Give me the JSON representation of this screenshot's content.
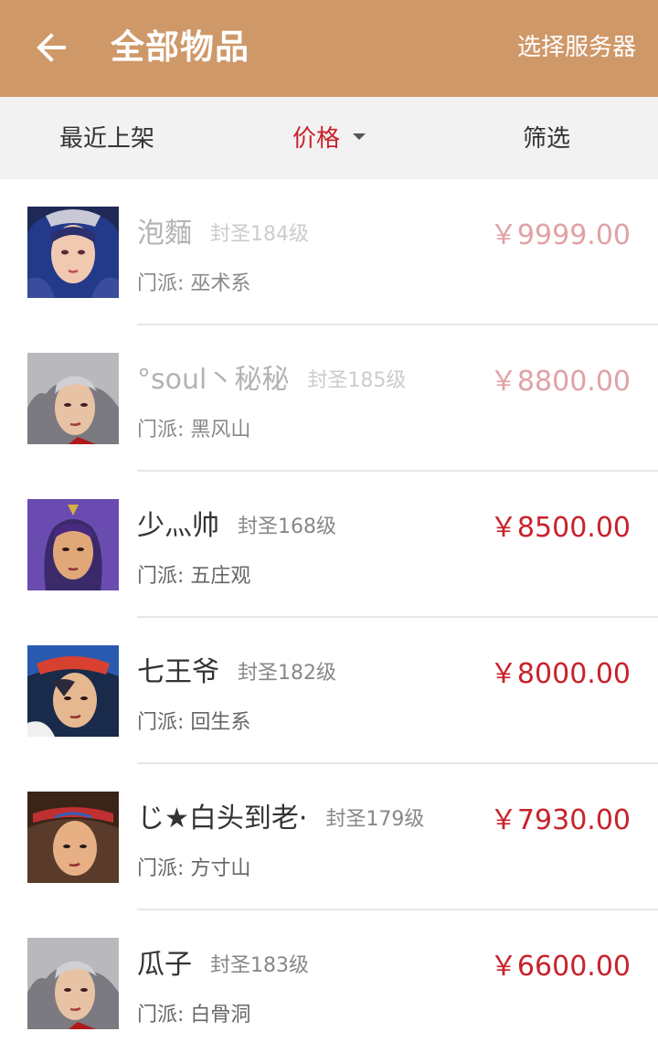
{
  "header": {
    "back_icon": "arrow-left-icon",
    "title": "全部物品",
    "server_label": "选择服务器",
    "color": "#cf9868"
  },
  "sortbar": {
    "recent_label": "最近上架",
    "price_label": "价格",
    "filter_label": "筛选",
    "active_color": "#c8222b"
  },
  "items": [
    {
      "name": "泡麵",
      "level": "封圣184级",
      "sect": "门派: 巫术系",
      "price": "￥9999.00",
      "faded": true
    },
    {
      "name": "°soul丶秘秘",
      "level": "封圣185级",
      "sect": "门派: 黑风山",
      "price": "￥8800.00",
      "faded": true
    },
    {
      "name": "少灬帅",
      "level": "封圣168级",
      "sect": "门派: 五庄观",
      "price": "￥8500.00",
      "faded": false
    },
    {
      "name": "七王爷",
      "level": "封圣182级",
      "sect": "门派: 回生系",
      "price": "￥8000.00",
      "faded": false
    },
    {
      "name": "じ★白头到老·",
      "level": "封圣179级",
      "sect": "门派: 方寸山",
      "price": "￥7930.00",
      "faded": false
    },
    {
      "name": "瓜子",
      "level": "封圣183级",
      "sect": "门派: 白骨洞",
      "price": "￥6600.00",
      "faded": false
    }
  ]
}
